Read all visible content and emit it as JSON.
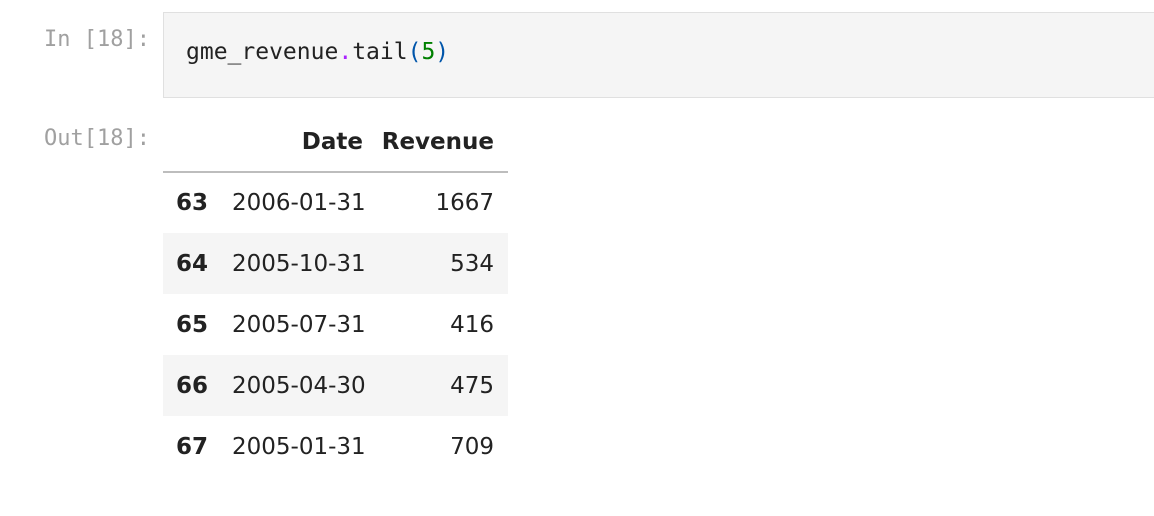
{
  "input_cell": {
    "prompt": "In [18]:",
    "code": {
      "object": "gme_revenue",
      "dot": ".",
      "method": "tail",
      "open_paren": "(",
      "arg": "5",
      "close_paren": ")"
    }
  },
  "output_cell": {
    "prompt": "Out[18]:",
    "columns": [
      "",
      "Date",
      "Revenue"
    ],
    "rows": [
      {
        "index": "63",
        "date": "2006-01-31",
        "revenue": "1667"
      },
      {
        "index": "64",
        "date": "2005-10-31",
        "revenue": "534"
      },
      {
        "index": "65",
        "date": "2005-07-31",
        "revenue": "416"
      },
      {
        "index": "66",
        "date": "2005-04-30",
        "revenue": "475"
      },
      {
        "index": "67",
        "date": "2005-01-31",
        "revenue": "709"
      }
    ]
  },
  "colors": {
    "prompt": "#a0a0a0",
    "input_bg": "#f5f5f5",
    "operator": "#aa22ff",
    "number": "#008000",
    "paren": "#0055aa",
    "stripe": "#f5f5f5"
  }
}
